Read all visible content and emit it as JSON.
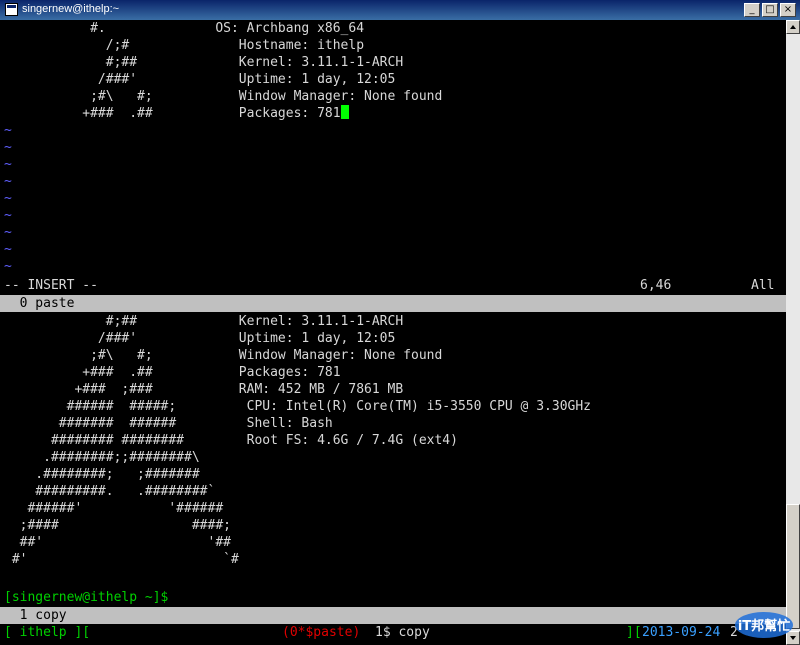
{
  "window": {
    "title": "singernew@ithelp:~",
    "buttons": [
      "_",
      "□",
      "×"
    ]
  },
  "top_pane": {
    "lines": [
      "           #.              OS: Archbang x86_64",
      "             /;#              Hostname: ithelp",
      "             #;##             Kernel: 3.11.1-1-ARCH",
      "            /###'             Uptime: 1 day, 12:05",
      "           ;#\\   #;           Window Manager: None found",
      "          +###  .##           Packages: 781"
    ],
    "tilde_count": 9,
    "status_mode": "-- INSERT --",
    "status_pos": "6,46",
    "status_all": "All"
  },
  "bar_paste": "  0 paste",
  "bottom_pane": {
    "lines": [
      "             #;##             Kernel: 3.11.1-1-ARCH",
      "            /###'             Uptime: 1 day, 12:05",
      "           ;#\\   #;           Window Manager: None found",
      "          +###  .##           Packages: 781",
      "         +###  ;###           RAM: 452 MB / 7861 MB",
      "        ######  #####;         CPU: Intel(R) Core(TM) i5-3550 CPU @ 3.30GHz",
      "       #######  ######         Shell: Bash",
      "      ######## ########        Root FS: 4.6G / 7.4G (ext4)",
      "     .########;;########\\",
      "    .########;   ;#######",
      "    #########.   .########`",
      "   ######'           '######",
      "  ;####                 ####;",
      "  ##'                     '##",
      " #'                         `#"
    ]
  },
  "prompt": "[singernew@ithelp ~]$",
  "bar_copy": "  1 copy",
  "tmux": {
    "left": "[ ithelp ][",
    "win0": "(0*$paste)",
    "win1": "1$ copy",
    "right_bracket": "][",
    "date": "2013-09-24",
    "time": "2"
  },
  "watermark": {
    "text": "iT邦幫忙"
  },
  "colors": {
    "cursor": "#00ff00",
    "tilde": "#5f5fff",
    "status_bar": "#c0c0c0",
    "green": "#00d000",
    "red": "#e00000",
    "blue": "#3aa0ff"
  }
}
